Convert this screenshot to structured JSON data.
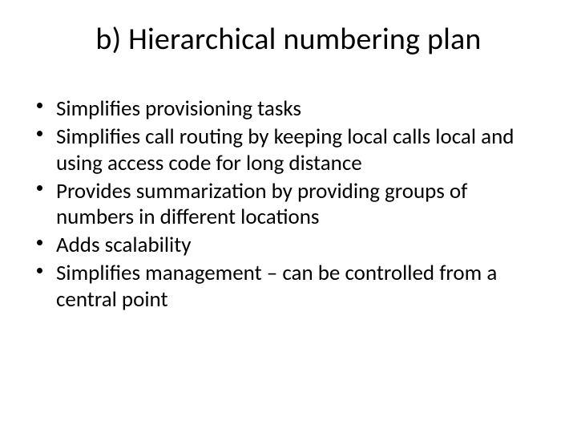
{
  "title": "b) Hierarchical numbering plan",
  "bullets": [
    "Simplifies provisioning tasks",
    "Simplifies call routing by keeping local calls local and using access code for long distance",
    "Provides summarization by providing groups of numbers in different locations",
    "Adds scalability",
    "Simplifies management – can be controlled from a central point"
  ]
}
